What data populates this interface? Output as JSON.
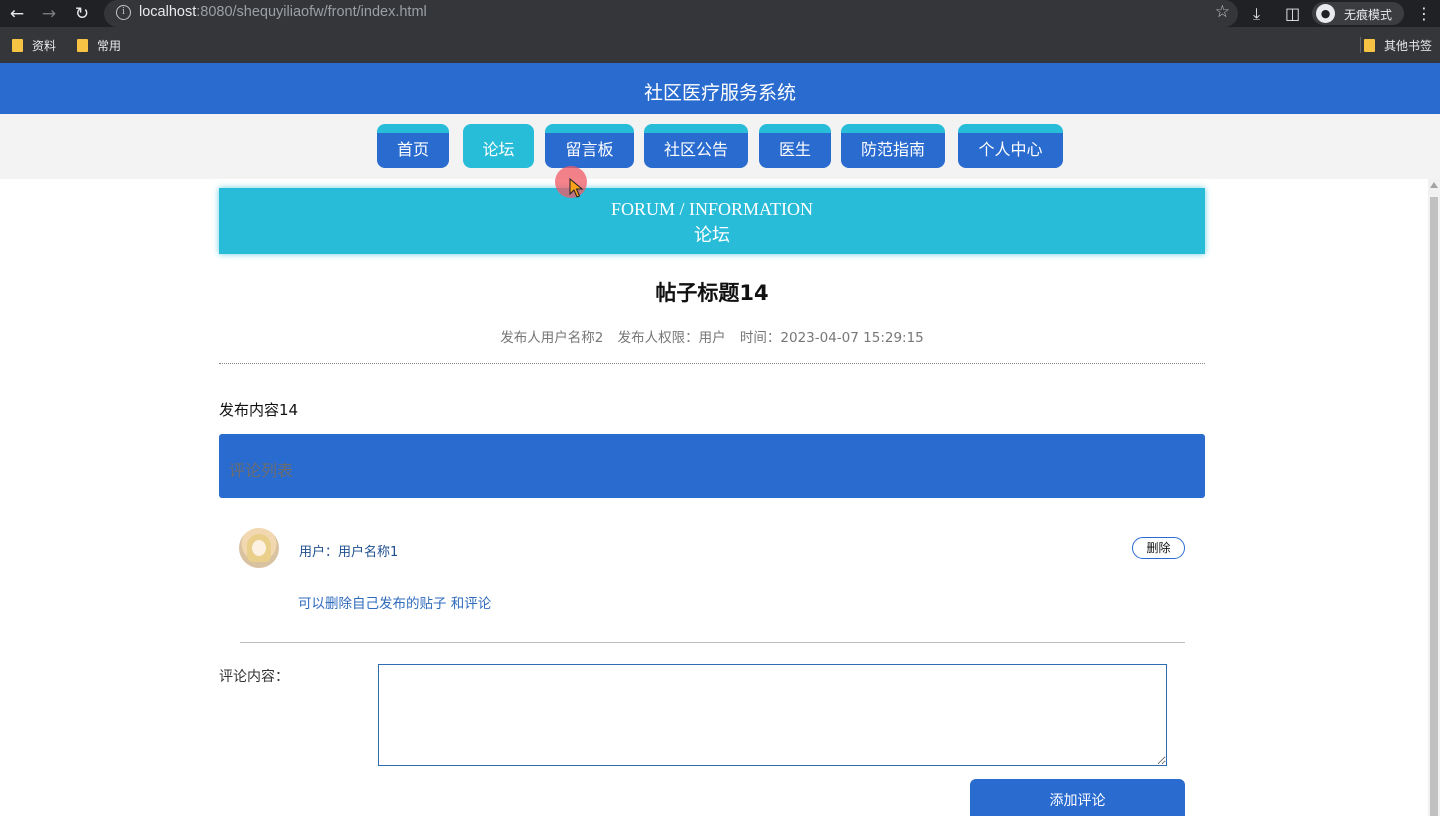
{
  "browser": {
    "url_host": "localhost",
    "url_rest": ":8080/shequyiliaofw/front/index.html",
    "incognito_label": "无痕模式",
    "bookmarks": [
      "资料",
      "常用"
    ],
    "other_bookmarks": "其他书签"
  },
  "site": {
    "title": "社区医疗服务系统",
    "nav": [
      "首页",
      "论坛",
      "留言板",
      "社区公告",
      "医生",
      "防范指南",
      "个人中心"
    ],
    "active_nav": "论坛"
  },
  "banner": {
    "en": "FORUM / INFORMATION",
    "cn": "论坛"
  },
  "post": {
    "title": "帖子标题14",
    "author": "发布人用户名称2",
    "permission": "发布人权限：用户",
    "time": "时间：2023-04-07 15:29:15",
    "content": "发布内容14"
  },
  "comments": {
    "section_label": "评论列表",
    "items": [
      {
        "user": "用户：用户名称1",
        "text": "可以删除自己发布的贴子 和评论",
        "delete_label": "删除"
      }
    ]
  },
  "form": {
    "label": "评论内容：",
    "placeholder": "",
    "submit_label": "添加评论"
  },
  "colors": {
    "primary": "#2a6bcf",
    "accent": "#27bcd8"
  }
}
